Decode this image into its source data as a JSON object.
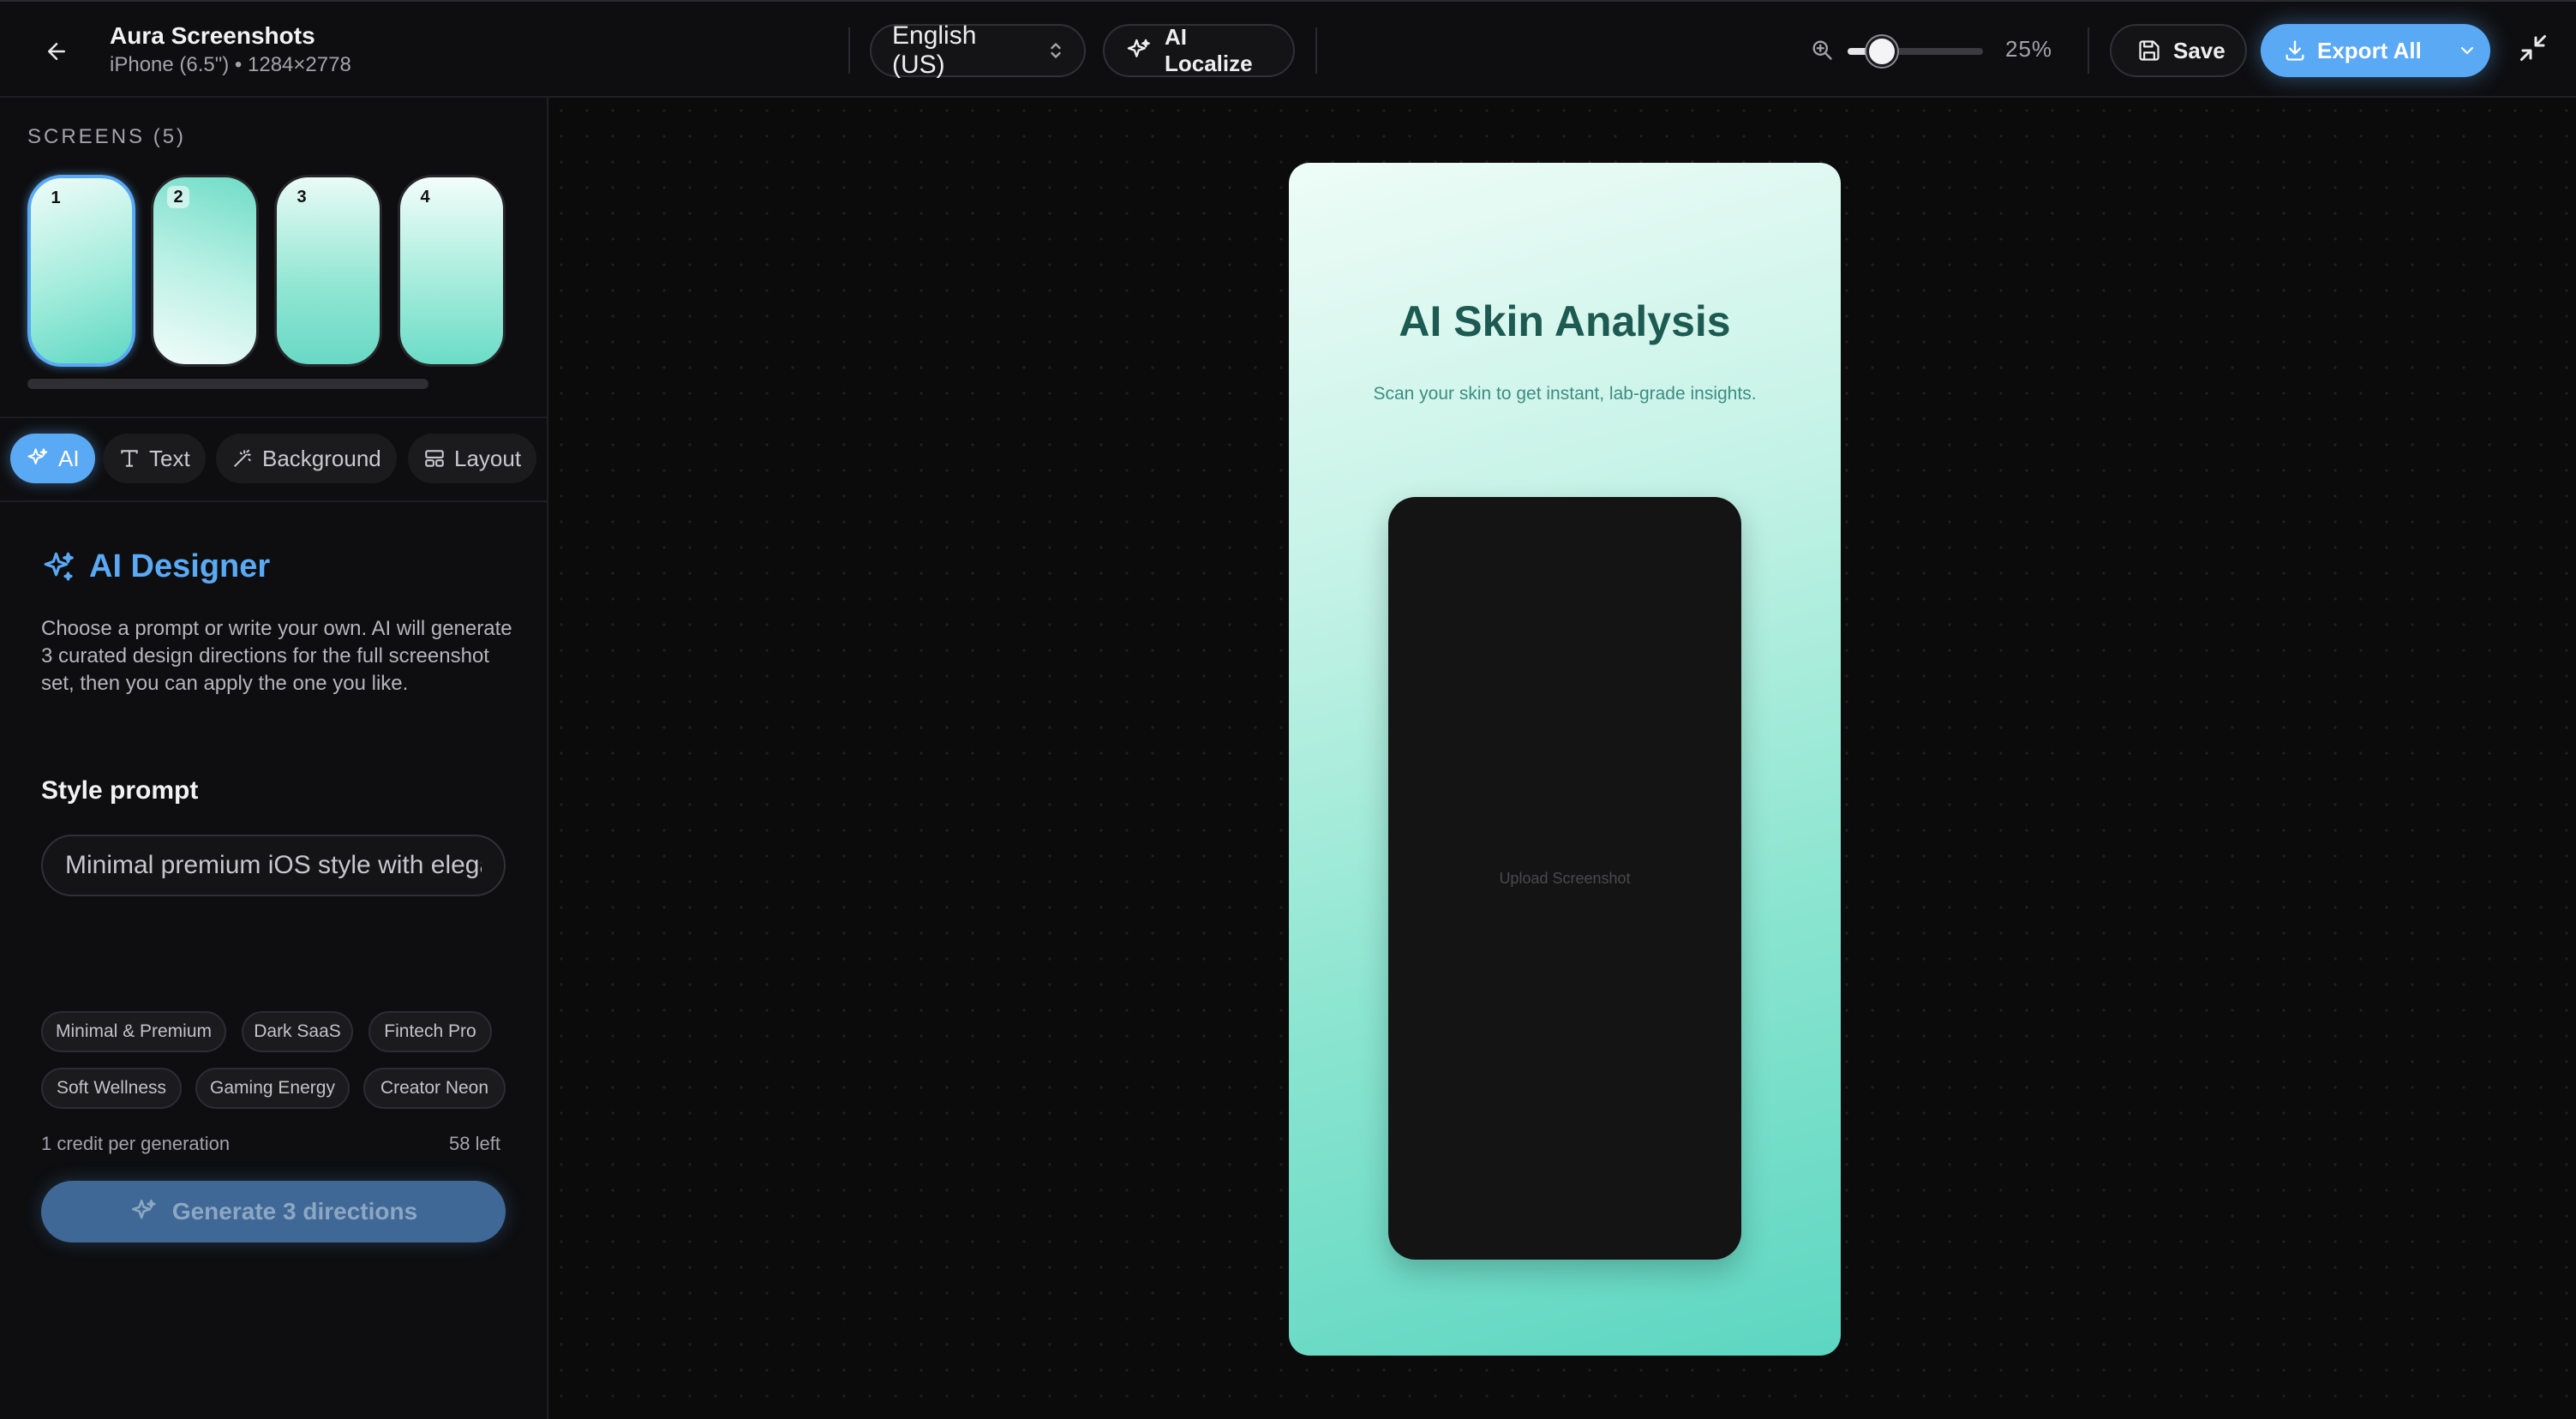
{
  "header": {
    "title": "Aura Screenshots",
    "subtitle": "iPhone (6.5\") • 1284×2778",
    "language": "English (US)",
    "ai_localize_label": "AI Localize",
    "zoom_value": "25%",
    "zoom_level": 0.25,
    "save_label": "Save",
    "export_label": "Export All"
  },
  "sidebar": {
    "screens_label": "SCREENS (5)",
    "thumbnails": [
      {
        "number": "1",
        "selected": true
      },
      {
        "number": "2",
        "selected": false
      },
      {
        "number": "3",
        "selected": false
      },
      {
        "number": "4",
        "selected": false
      }
    ],
    "tabs": [
      {
        "label": "AI",
        "active": true
      },
      {
        "label": "Text",
        "active": false
      },
      {
        "label": "Background",
        "active": false
      },
      {
        "label": "Layout",
        "active": false
      }
    ],
    "ai_designer": {
      "title": "AI Designer",
      "description": "Choose a prompt or write your own. AI will generate 3 curated design directions for the full screenshot set, then you can apply the one you like.",
      "style_prompt_label": "Style prompt",
      "style_prompt_value": "Minimal premium iOS style with elegant typography",
      "presets": [
        "Minimal & Premium",
        "Dark SaaS",
        "Fintech Pro",
        "Soft Wellness",
        "Gaming Energy",
        "Creator Neon"
      ],
      "credit_text": "1 credit per generation",
      "credits_left": "58 left",
      "generate_label": "Generate 3 directions"
    }
  },
  "canvas": {
    "headline": "AI Skin Analysis",
    "subheadline": "Scan your skin to get instant, lab-grade insights.",
    "upload_label": "Upload Screenshot"
  },
  "colors": {
    "accent": "#5aa9f5",
    "headline": "#1d5a52",
    "gradient_top": "#eefcf7",
    "gradient_bottom": "#5dd6c1"
  },
  "icons": {
    "back": "arrow-left-icon",
    "language": "chevron-up-down-icon",
    "localize": "sparkles-icon",
    "zoom": "zoom-in-icon",
    "save": "floppy-disk-icon",
    "export": "download-icon",
    "export_menu": "chevron-down-icon",
    "collapse": "minimize-icon"
  }
}
